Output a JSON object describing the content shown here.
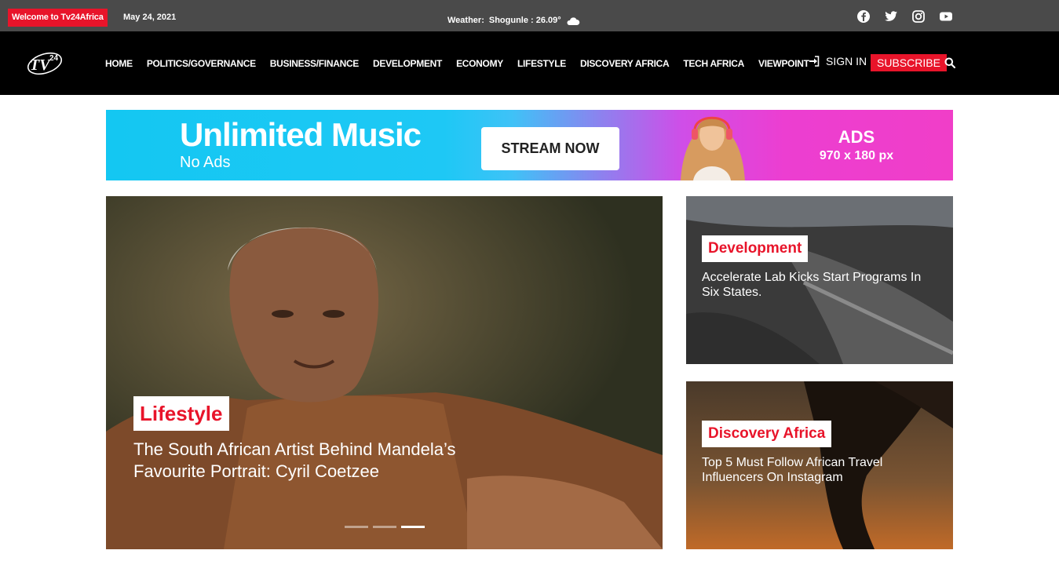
{
  "topbar": {
    "welcome": "Welcome to Tv24Africa",
    "date": "May 24, 2021",
    "weather_label": "Weather:",
    "weather_value": "Shogunle : 26.09°",
    "social": [
      "facebook-icon",
      "twitter-icon",
      "instagram-icon",
      "youtube-icon"
    ]
  },
  "nav": {
    "items": [
      "HOME",
      "POLITICS/GOVERNANCE",
      "BUSINESS/FINANCE",
      "DEVELOPMENT",
      "ECONOMY",
      "LIFESTYLE",
      "DISCOVERY AFRICA",
      "TECH AFRICA",
      "VIEWPOINT"
    ],
    "signin": "SIGN IN",
    "subscribe": "SUBSCRIBE"
  },
  "ad": {
    "title": "Unlimited Music",
    "subtitle": "No Ads",
    "button": "STREAM NOW",
    "label": "ADS",
    "size": "970 x 180 px"
  },
  "hero": {
    "category": "Lifestyle",
    "title": "The South African Artist Behind Mandela’s Favourite Portrait: Cyril Coetzee",
    "slides": 3,
    "active_slide": 3
  },
  "cards": [
    {
      "category": "Development",
      "title": "Accelerate Lab Kicks Start Programs In Six States."
    },
    {
      "category": "Discovery Africa",
      "title": "Top 5 Must Follow African Travel Influencers On Instagram"
    }
  ],
  "colors": {
    "accent": "#e8142a",
    "topbar": "#4a4a4a",
    "nav": "#000000"
  }
}
